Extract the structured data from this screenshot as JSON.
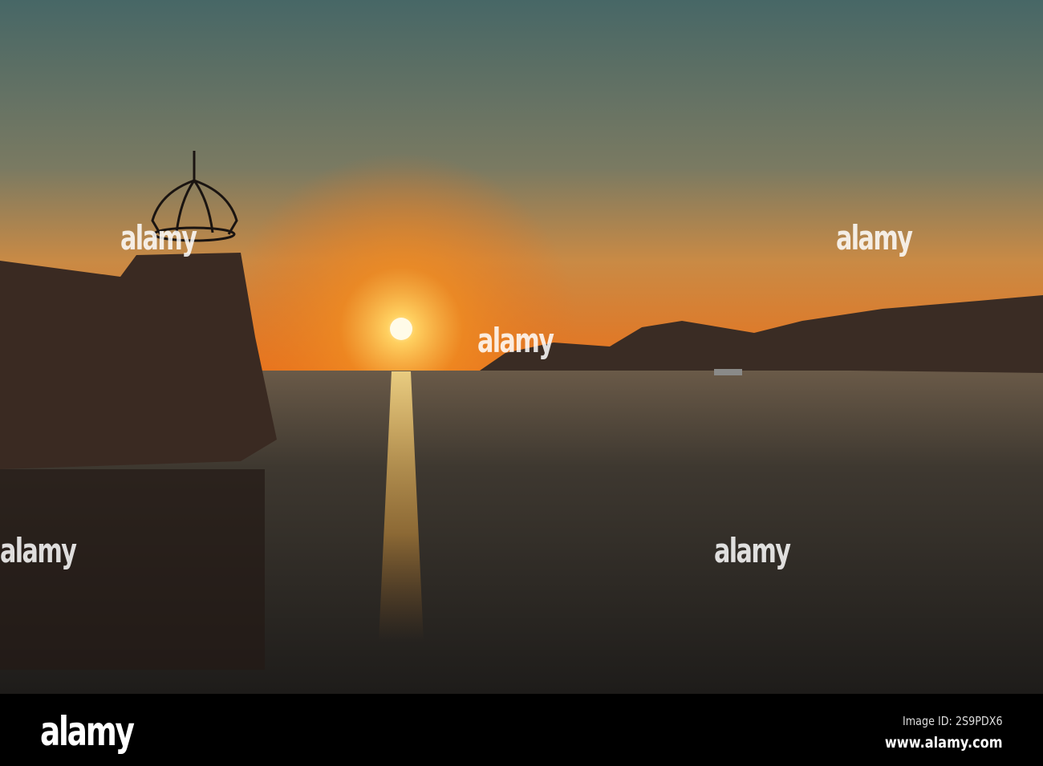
{
  "watermark": {
    "text": "alamy",
    "small_mark": "a"
  },
  "footer": {
    "logo": "alamy",
    "image_id": "Image ID: 2S9PDX6",
    "url": "www.alamy.com"
  },
  "colors": {
    "sky_top": "#476766",
    "horizon": "#e8731d",
    "sun": "#fff6c8",
    "water": "#2a2622",
    "silhouette": "#2c2320"
  }
}
